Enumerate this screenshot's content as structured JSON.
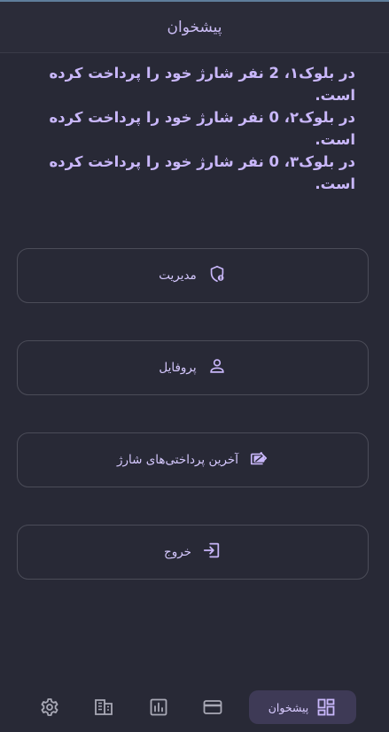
{
  "appbar": {
    "title": "پیشخوان"
  },
  "summary": [
    "در بلوک۱، 2 نفر شارژ خود را پرداخت کرده است.",
    "در بلوک۲، 0 نفر شارژ خود را پرداخت کرده است.",
    "در بلوک۳، 0 نفر شارژ خود را پرداخت کرده است."
  ],
  "menu": [
    {
      "label": "مدیریت",
      "icon": "admin-shield-icon"
    },
    {
      "label": "پروفایل",
      "icon": "person-icon"
    },
    {
      "label": "آخرین پرداختی‌های شارژ",
      "icon": "payments-icon"
    },
    {
      "label": "خروج",
      "icon": "logout-icon"
    }
  ],
  "bottom_nav": {
    "active_label": "پیشخوان",
    "items": [
      "settings-icon",
      "building-icon",
      "chart-icon",
      "card-icon",
      "dashboard-icon"
    ]
  },
  "colors": {
    "background": "#282936",
    "accent": "#c9b7fa",
    "active_nav": "#3e3a56"
  }
}
